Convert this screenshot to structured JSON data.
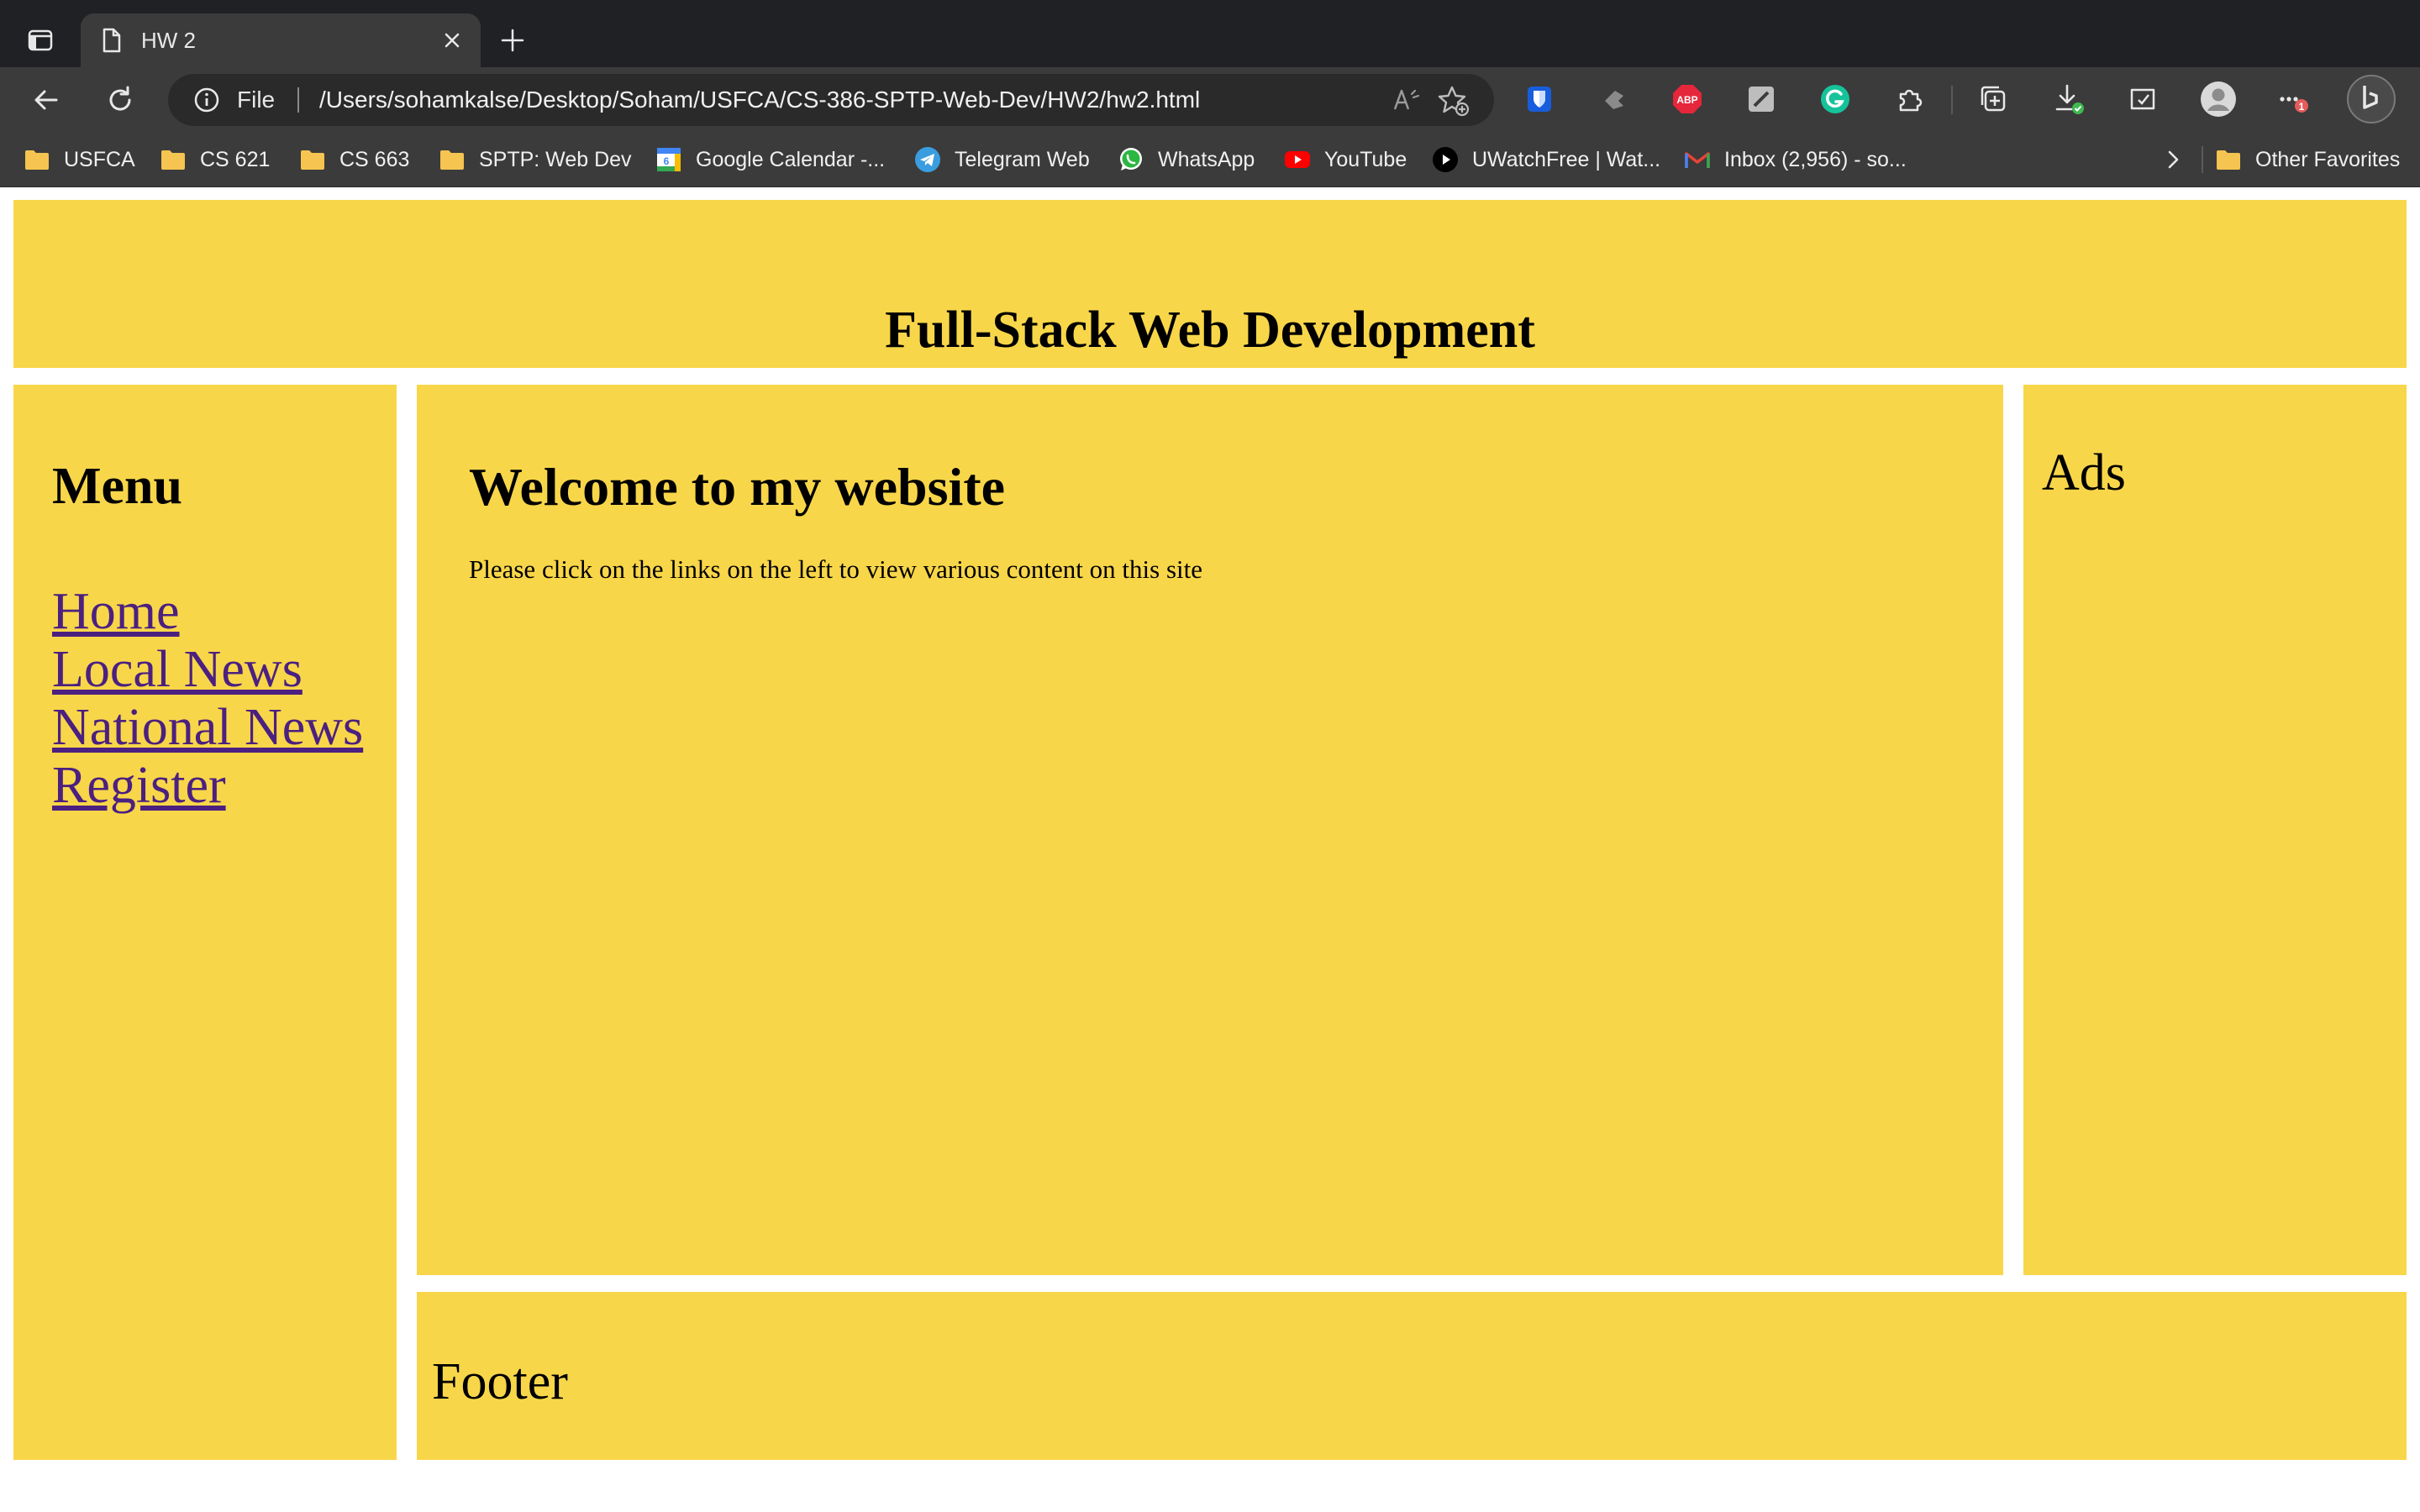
{
  "browser": {
    "tab": {
      "title": "HW 2"
    },
    "address_bar": {
      "scheme_label": "File",
      "url": "/Users/sohamkalse/Desktop/Soham/USFCA/CS-386-SPTP-Web-Dev/HW2/hw2.html"
    },
    "extensions": {
      "abp_label": "ABP",
      "notification_badge": "1"
    },
    "bookmarks": [
      {
        "label": "USFCA",
        "icon": "folder-icon"
      },
      {
        "label": "CS 621",
        "icon": "folder-icon"
      },
      {
        "label": "CS 663",
        "icon": "folder-icon"
      },
      {
        "label": "SPTP: Web Dev",
        "icon": "folder-icon"
      },
      {
        "label": "Google Calendar -...",
        "icon": "google-calendar-icon"
      },
      {
        "label": "Telegram Web",
        "icon": "telegram-icon"
      },
      {
        "label": "WhatsApp",
        "icon": "whatsapp-icon"
      },
      {
        "label": "YouTube",
        "icon": "youtube-icon"
      },
      {
        "label": "UWatchFree | Wat...",
        "icon": "play-icon"
      },
      {
        "label": "Inbox (2,956) - so...",
        "icon": "gmail-icon"
      }
    ],
    "other_favorites": "Other Favorites"
  },
  "page": {
    "header": {
      "title": "Full-Stack Web Development"
    },
    "sidebar": {
      "heading": "Menu",
      "links": [
        "Home",
        "Local News",
        "National News",
        "Register"
      ]
    },
    "main": {
      "heading": "Welcome to my website",
      "text": "Please click on the links on the left to view various content on this site"
    },
    "ads": {
      "label": "Ads"
    },
    "footer": {
      "label": "Footer"
    }
  },
  "colors": {
    "panel": "#f8d649",
    "link": "#4b2080",
    "chrome_dark": "#202124",
    "chrome": "#3b3b3b"
  }
}
